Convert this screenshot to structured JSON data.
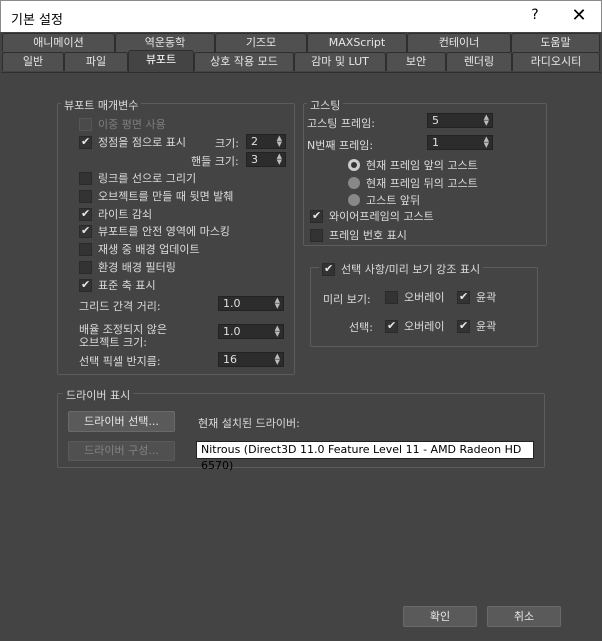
{
  "window": {
    "title": "기본 설정",
    "help": "?",
    "close": "✕"
  },
  "tabs_row1": [
    "애니메이션",
    "역운동학",
    "기즈모",
    "MAXScript",
    "컨테이너",
    "도움말"
  ],
  "tabs_row2": [
    "일반",
    "파일",
    "뷰포트",
    "상호 작용 모드",
    "감마 및 LUT",
    "보안",
    "렌더링",
    "라디오시티"
  ],
  "viewport_params": {
    "title": "뷰포트 매개변수",
    "dual_plane": "이중 평면 사용",
    "vertex_dots": "정점을 점으로 표시",
    "size_label": "크기:",
    "size_value": "2",
    "handle_size_label": "핸들 크기:",
    "handle_size_value": "3",
    "draw_links": "링크를 선으로 그리기",
    "backface_cull": "오브젝트를 만들 때 뒷면 발췌",
    "attenuate_lights": "라이트 감쇠",
    "mask_safe": "뷰포트를 안전 영역에 마스킹",
    "update_bg": "재생 중 배경 업데이트",
    "filter_env": "환경 배경 필터링",
    "display_axis": "표준 축 표시",
    "grid_nudge_label": "그리드 간격 거리:",
    "grid_nudge_value": "1.0",
    "non_scaled_label1": "배율 조정되지 않은",
    "non_scaled_label2": "오브젝트 크기:",
    "non_scaled_value": "1.0",
    "pick_radius_label": "선택 픽셀 반지름:",
    "pick_radius_value": "16"
  },
  "ghosting": {
    "title": "고스팅",
    "frames_label": "고스팅 프레임:",
    "frames_value": "5",
    "nth_label": "N번째 프레임:",
    "nth_value": "1",
    "before": "현재 프레임 앞의 고스트",
    "after": "현재 프레임 뒤의 고스트",
    "both": "고스트 앞뒤",
    "wireframe": "와이어프레임의 고스트",
    "frame_numbers": "프레임 번호 표시"
  },
  "highlight": {
    "title": "선택 사항/미리 보기 강조 표시",
    "preview_label": "미리 보기:",
    "select_label": "선택:",
    "overlay": "오버레이",
    "outline": "윤곽"
  },
  "driver": {
    "title": "드라이버 표시",
    "choose": "드라이버 선택...",
    "configure": "드라이버 구성...",
    "installed_label": "현재 설치된 드라이버:",
    "installed_value": "Nitrous (Direct3D 11.0 Feature Level 11 - AMD Radeon HD 6570)"
  },
  "buttons": {
    "ok": "확인",
    "cancel": "취소"
  }
}
